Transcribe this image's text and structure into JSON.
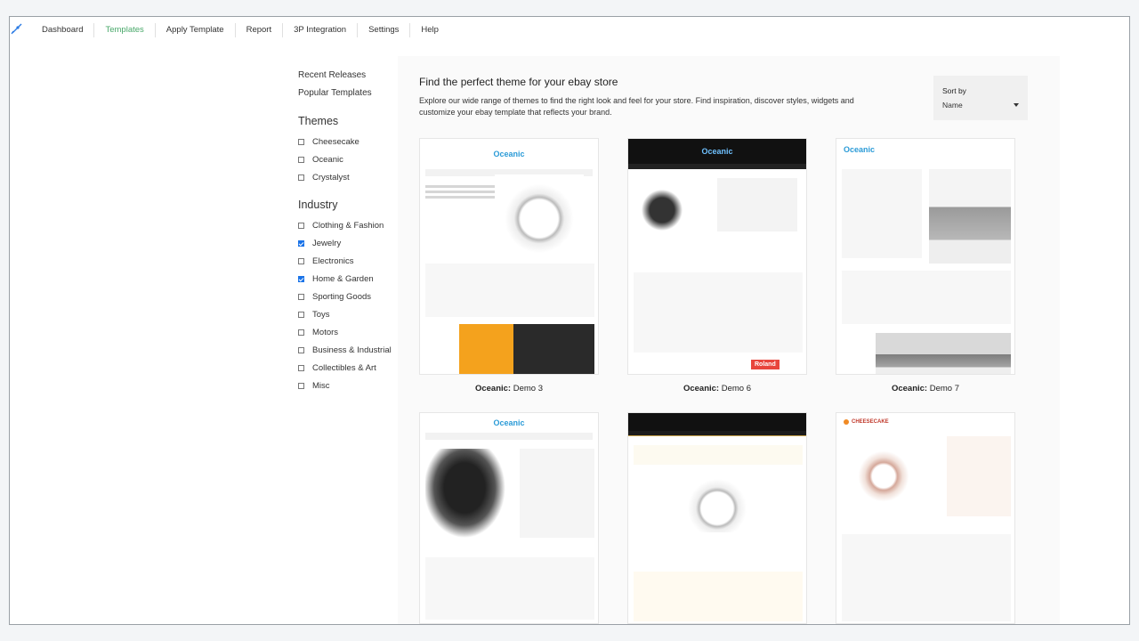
{
  "nav": {
    "items": [
      {
        "label": "Dashboard",
        "active": false
      },
      {
        "label": "Templates",
        "active": true
      },
      {
        "label": "Apply Template",
        "active": false
      },
      {
        "label": "Report",
        "active": false
      },
      {
        "label": "3P Integration",
        "active": false
      },
      {
        "label": "Settings",
        "active": false
      },
      {
        "label": "Help",
        "active": false
      }
    ]
  },
  "sidebar": {
    "links": [
      "Recent Releases",
      "Popular Templates"
    ],
    "themes_heading": "Themes",
    "themes": [
      {
        "label": "Cheesecake",
        "checked": false
      },
      {
        "label": "Oceanic",
        "checked": false
      },
      {
        "label": "Crystalyst",
        "checked": false
      }
    ],
    "industry_heading": "Industry",
    "industry": [
      {
        "label": "Clothing & Fashion",
        "checked": false
      },
      {
        "label": "Jewelry",
        "checked": true
      },
      {
        "label": "Electronics",
        "checked": false
      },
      {
        "label": "Home & Garden",
        "checked": true
      },
      {
        "label": "Sporting Goods",
        "checked": false
      },
      {
        "label": "Toys",
        "checked": false
      },
      {
        "label": "Motors",
        "checked": false
      },
      {
        "label": "Business & Industrial",
        "checked": false
      },
      {
        "label": "Collectibles & Art",
        "checked": false
      },
      {
        "label": "Misc",
        "checked": false
      }
    ]
  },
  "main": {
    "title": "Find the perfect theme for your ebay store",
    "description": "Explore our wide range of themes to find the right look and feel for your store. Find inspiration, discover styles, widgets and customize your ebay template that reflects your brand.",
    "sort": {
      "label": "Sort by",
      "value": "Name"
    }
  },
  "templates": [
    {
      "theme": "Oceanic:",
      "name": "Demo 3",
      "logo": "Oceanic"
    },
    {
      "theme": "Oceanic:",
      "name": "Demo 6",
      "logo": "Oceanic",
      "brand": "Roland"
    },
    {
      "theme": "Oceanic:",
      "name": "Demo 7",
      "logo": "Oceanic"
    },
    {
      "logo": "Oceanic"
    },
    {},
    {
      "logo": "CHEESECAKE"
    }
  ],
  "colors": {
    "accent_active_nav": "#49a86a",
    "checkbox_checked": "#1a73e8",
    "oceanic_logo": "#2b9bd7",
    "promo_orange": "#f4a21d",
    "roland_red": "#e8453c"
  },
  "icons": {
    "logo": "rocket-icon",
    "sort_caret": "caret-down-icon"
  }
}
